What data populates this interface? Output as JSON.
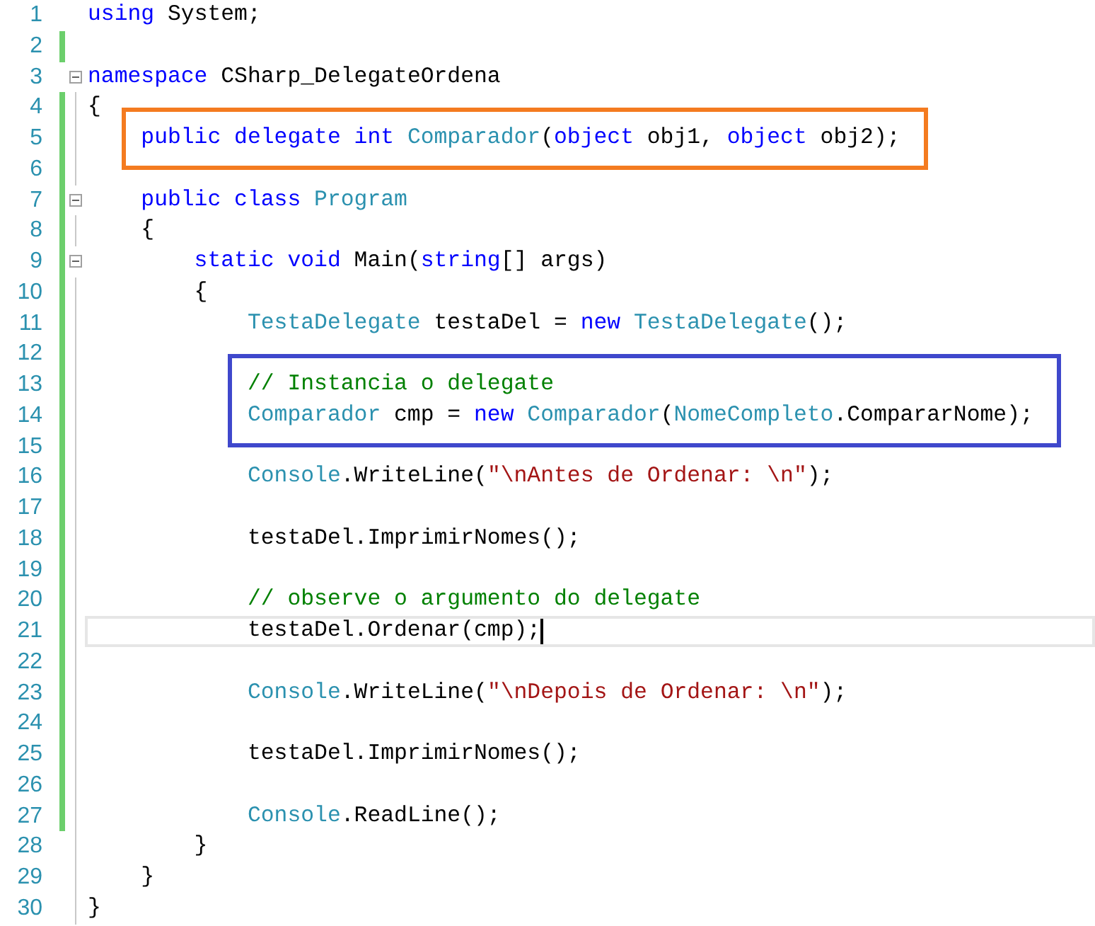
{
  "editor": {
    "lines": [
      {
        "kind": "line",
        "number": "1",
        "changed": false,
        "fold_marker": false,
        "current": false,
        "tokens": [
          {
            "kind": "keyword",
            "text": "using"
          },
          {
            "kind": "plain",
            "text": " System;"
          }
        ]
      },
      {
        "kind": "line",
        "number": "2",
        "changed": true,
        "fold_marker": false,
        "current": false
      },
      {
        "kind": "line",
        "number": "3",
        "changed": false,
        "fold_marker": true,
        "current": false,
        "tokens": [
          {
            "kind": "keyword",
            "text": "namespace"
          },
          {
            "kind": "plain",
            "text": " CSharp_DelegateOrdena"
          }
        ]
      },
      {
        "kind": "line",
        "number": "4",
        "changed": true,
        "fold_marker": false,
        "current": false,
        "tokens": [
          {
            "kind": "plain",
            "text": "{"
          }
        ]
      },
      {
        "kind": "box",
        "color": "#f47b20",
        "lines": [
          {
            "kind": "line",
            "number": "5",
            "changed": true,
            "fold_marker": false,
            "current": false,
            "tokens": [
              {
                "kind": "keyword",
                "text": "    public delegate int "
              },
              {
                "kind": "type",
                "text": "Comparador"
              },
              {
                "kind": "plain",
                "text": "("
              },
              {
                "kind": "keyword",
                "text": "object"
              },
              {
                "kind": "plain",
                "text": " obj1, "
              },
              {
                "kind": "keyword",
                "text": "object"
              },
              {
                "kind": "plain",
                "text": " obj2);"
              }
            ]
          }
        ]
      },
      {
        "kind": "line",
        "number": "6",
        "changed": true,
        "fold_marker": false,
        "current": false
      },
      {
        "kind": "line",
        "number": "7",
        "changed": true,
        "fold_marker": true,
        "current": false,
        "tokens": [
          {
            "kind": "keyword",
            "text": "    public class "
          },
          {
            "kind": "type",
            "text": "Program"
          }
        ]
      },
      {
        "kind": "line",
        "number": "8",
        "changed": true,
        "fold_marker": false,
        "current": false,
        "tokens": [
          {
            "kind": "plain",
            "text": "    {"
          }
        ]
      },
      {
        "kind": "line",
        "number": "9",
        "changed": true,
        "fold_marker": true,
        "current": false,
        "tokens": [
          {
            "kind": "keyword",
            "text": "        static void"
          },
          {
            "kind": "plain",
            "text": " Main("
          },
          {
            "kind": "keyword",
            "text": "string"
          },
          {
            "kind": "plain",
            "text": "[] args)"
          }
        ]
      },
      {
        "kind": "line",
        "number": "10",
        "changed": true,
        "fold_marker": false,
        "current": false,
        "tokens": [
          {
            "kind": "plain",
            "text": "        {"
          }
        ]
      },
      {
        "kind": "line",
        "number": "11",
        "changed": true,
        "fold_marker": false,
        "current": false,
        "tokens": [
          {
            "kind": "type",
            "text": "            TestaDelegate"
          },
          {
            "kind": "plain",
            "text": " testaDel = "
          },
          {
            "kind": "keyword",
            "text": "new "
          },
          {
            "kind": "type",
            "text": "TestaDelegate"
          },
          {
            "kind": "plain",
            "text": "();"
          }
        ]
      },
      {
        "kind": "line",
        "number": "12",
        "changed": true,
        "fold_marker": false,
        "current": false
      },
      {
        "kind": "box",
        "color": "#3f48cc",
        "lines": [
          {
            "kind": "line",
            "number": "13",
            "changed": true,
            "fold_marker": false,
            "current": false,
            "tokens": [
              {
                "kind": "comment",
                "text": "            // Instancia o delegate"
              }
            ]
          },
          {
            "kind": "line",
            "number": "14",
            "changed": true,
            "fold_marker": false,
            "current": false,
            "tokens": [
              {
                "kind": "type",
                "text": "            Comparador"
              },
              {
                "kind": "plain",
                "text": " cmp = "
              },
              {
                "kind": "keyword",
                "text": "new "
              },
              {
                "kind": "type",
                "text": "Comparador"
              },
              {
                "kind": "plain",
                "text": "("
              },
              {
                "kind": "type",
                "text": "NomeCompleto"
              },
              {
                "kind": "plain",
                "text": ".CompararNome);"
              }
            ]
          }
        ]
      },
      {
        "kind": "line",
        "number": "15",
        "changed": true,
        "fold_marker": false,
        "current": false
      },
      {
        "kind": "line",
        "number": "16",
        "changed": true,
        "fold_marker": false,
        "current": false,
        "tokens": [
          {
            "kind": "type",
            "text": "            Console"
          },
          {
            "kind": "plain",
            "text": ".WriteLine("
          },
          {
            "kind": "string",
            "text": "\"\\nAntes de Ordenar: \\n\""
          },
          {
            "kind": "plain",
            "text": ");"
          }
        ]
      },
      {
        "kind": "line",
        "number": "17",
        "changed": true,
        "fold_marker": false,
        "current": false
      },
      {
        "kind": "line",
        "number": "18",
        "changed": true,
        "fold_marker": false,
        "current": false,
        "tokens": [
          {
            "kind": "plain",
            "text": "            testaDel.ImprimirNomes();"
          }
        ]
      },
      {
        "kind": "line",
        "number": "19",
        "changed": true,
        "fold_marker": false,
        "current": false
      },
      {
        "kind": "line",
        "number": "20",
        "changed": true,
        "fold_marker": false,
        "current": false,
        "tokens": [
          {
            "kind": "comment",
            "text": "            // observe o argumento do delegate"
          }
        ]
      },
      {
        "kind": "line",
        "number": "21",
        "changed": true,
        "fold_marker": false,
        "current": true,
        "tokens": [
          {
            "kind": "plain",
            "text": "            testaDel.Ordenar(cmp);"
          }
        ]
      },
      {
        "kind": "line",
        "number": "22",
        "changed": true,
        "fold_marker": false,
        "current": false
      },
      {
        "kind": "line",
        "number": "23",
        "changed": true,
        "fold_marker": false,
        "current": false,
        "tokens": [
          {
            "kind": "type",
            "text": "            Console"
          },
          {
            "kind": "plain",
            "text": ".WriteLine("
          },
          {
            "kind": "string",
            "text": "\"\\nDepois de Ordenar: \\n\""
          },
          {
            "kind": "plain",
            "text": ");"
          }
        ]
      },
      {
        "kind": "line",
        "number": "24",
        "changed": true,
        "fold_marker": false,
        "current": false
      },
      {
        "kind": "line",
        "number": "25",
        "changed": true,
        "fold_marker": false,
        "current": false,
        "tokens": [
          {
            "kind": "plain",
            "text": "            testaDel.ImprimirNomes();"
          }
        ]
      },
      {
        "kind": "line",
        "number": "26",
        "changed": true,
        "fold_marker": false,
        "current": false
      },
      {
        "kind": "line",
        "number": "27",
        "changed": true,
        "fold_marker": false,
        "current": false,
        "tokens": [
          {
            "kind": "type",
            "text": "            Console"
          },
          {
            "kind": "plain",
            "text": ".ReadLine();"
          }
        ]
      },
      {
        "kind": "line",
        "number": "28",
        "changed": false,
        "fold_marker": false,
        "current": false,
        "tokens": [
          {
            "kind": "plain",
            "text": "        }"
          }
        ]
      },
      {
        "kind": "line",
        "number": "29",
        "changed": false,
        "fold_marker": false,
        "current": false,
        "tokens": [
          {
            "kind": "plain",
            "text": "    }"
          }
        ]
      },
      {
        "kind": "line",
        "number": "30",
        "changed": false,
        "fold_marker": false,
        "current": false,
        "tokens": [
          {
            "kind": "plain",
            "text": "}"
          }
        ]
      }
    ]
  }
}
